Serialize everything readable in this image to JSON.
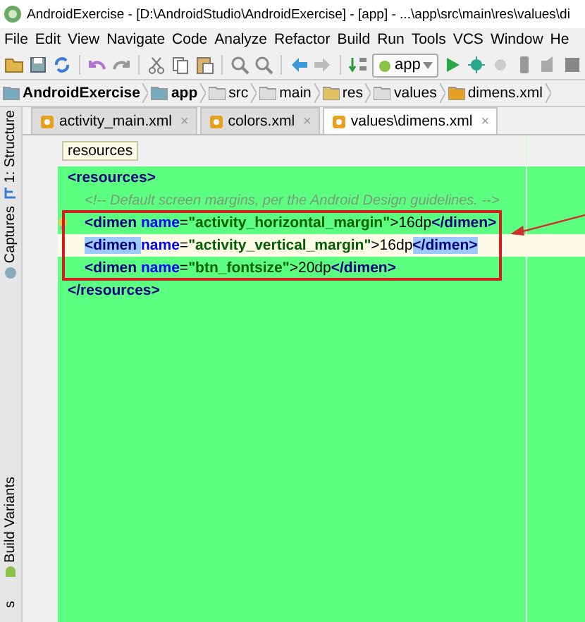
{
  "window": {
    "title": "AndroidExercise - [D:\\AndroidStudio\\AndroidExercise] - [app] - ...\\app\\src\\main\\res\\values\\di"
  },
  "menu": [
    "File",
    "Edit",
    "View",
    "Navigate",
    "Code",
    "Analyze",
    "Refactor",
    "Build",
    "Run",
    "Tools",
    "VCS",
    "Window",
    "He"
  ],
  "toolbar": {
    "run_config": "app"
  },
  "breadcrumbs": [
    {
      "label": "AndroidExercise",
      "kind": "module"
    },
    {
      "label": "app",
      "kind": "module"
    },
    {
      "label": "src",
      "kind": "folder"
    },
    {
      "label": "main",
      "kind": "folder"
    },
    {
      "label": "res",
      "kind": "res"
    },
    {
      "label": "values",
      "kind": "folder"
    },
    {
      "label": "dimens.xml",
      "kind": "file"
    }
  ],
  "tabs": [
    {
      "label": "activity_main.xml",
      "selected": false,
      "close": "×"
    },
    {
      "label": "colors.xml",
      "selected": false,
      "close": "×"
    },
    {
      "label": "values\\dimens.xml",
      "selected": true,
      "close": "×"
    }
  ],
  "side_tools": [
    {
      "label": "1: Structure",
      "kind": "structure"
    },
    {
      "label": "Captures",
      "kind": "captures"
    },
    {
      "label": "Build Variants",
      "kind": "android"
    },
    {
      "label": "s",
      "kind": "none"
    }
  ],
  "editor": {
    "crumb": "resources",
    "lines": [
      {
        "tokens": [
          {
            "kind": "tag",
            "text": "<resources>"
          }
        ],
        "children": [
          {
            "tokens": [
              {
                "kind": "comment",
                "text": "<!-- Default screen margins, per the Android Design guidelines. -->"
              }
            ]
          },
          {
            "boxed": true,
            "bulb": true,
            "current": false,
            "tokens": [
              {
                "kind": "tag",
                "text": "<dimen "
              },
              {
                "kind": "attr",
                "text": "name"
              },
              {
                "kind": "text",
                "text": "="
              },
              {
                "kind": "value",
                "text": "\"activity_horizontal_margin\""
              },
              {
                "kind": "text",
                "text": ">16dp"
              },
              {
                "kind": "tag",
                "text": "</dimen>"
              }
            ]
          },
          {
            "boxed": true,
            "bulb": false,
            "current": true,
            "tokens": [
              {
                "kind": "tag",
                "text": "<dimen ",
                "matched": true
              },
              {
                "kind": "attr",
                "text": "name"
              },
              {
                "kind": "text",
                "text": "="
              },
              {
                "kind": "value",
                "text": "\"activity_vertical_margin\""
              },
              {
                "kind": "text",
                "text": ">16dp"
              },
              {
                "kind": "tag",
                "text": "</dimen>",
                "matched": true
              }
            ]
          },
          {
            "boxed": true,
            "bulb": false,
            "current": false,
            "tokens": [
              {
                "kind": "tag",
                "text": "<dimen "
              },
              {
                "kind": "attr",
                "text": "name"
              },
              {
                "kind": "text",
                "text": "="
              },
              {
                "kind": "value",
                "text": "\"btn_fontsize\""
              },
              {
                "kind": "text",
                "text": ">20dp"
              },
              {
                "kind": "tag",
                "text": "</dimen>"
              }
            ]
          }
        ]
      },
      {
        "tokens": [
          {
            "kind": "tag",
            "text": "</resources>"
          }
        ]
      }
    ]
  }
}
